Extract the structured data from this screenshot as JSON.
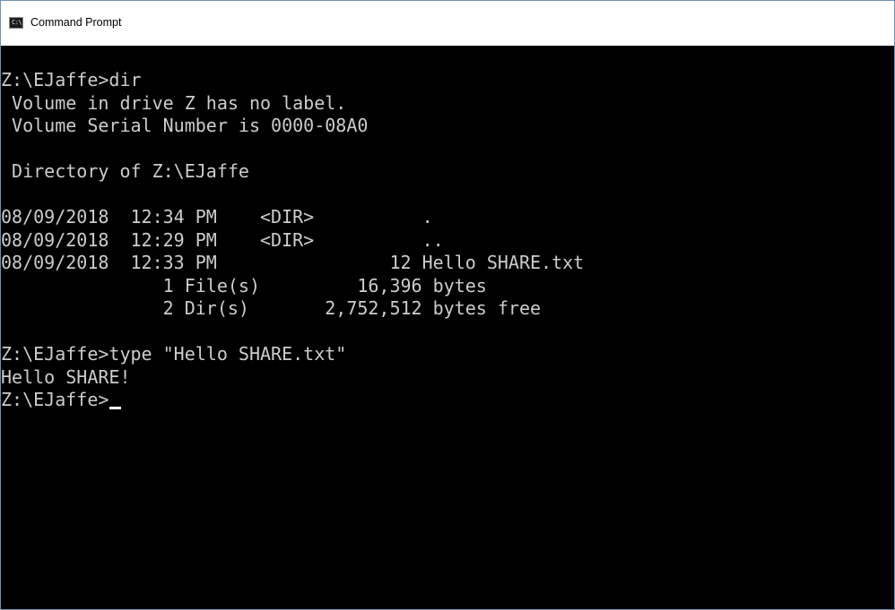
{
  "window": {
    "title": "Command Prompt",
    "icon": "cmd-app-icon",
    "icon_text": "C:\\"
  },
  "colors": {
    "console_background": "#000000",
    "console_text": "#cccccc",
    "titlebar_background": "#ffffff"
  },
  "console": {
    "lines": [
      "Z:\\EJaffe>dir",
      " Volume in drive Z has no label.",
      " Volume Serial Number is 0000-08A0",
      "",
      " Directory of Z:\\EJaffe",
      "",
      "08/09/2018  12:34 PM    <DIR>          .",
      "08/09/2018  12:29 PM    <DIR>          ..",
      "08/09/2018  12:33 PM                12 Hello SHARE.txt",
      "               1 File(s)         16,396 bytes",
      "               2 Dir(s)       2,752,512 bytes free",
      "",
      "Z:\\EJaffe>type \"Hello SHARE.txt\"",
      "Hello SHARE!"
    ],
    "prompt": "Z:\\EJaffe>"
  }
}
